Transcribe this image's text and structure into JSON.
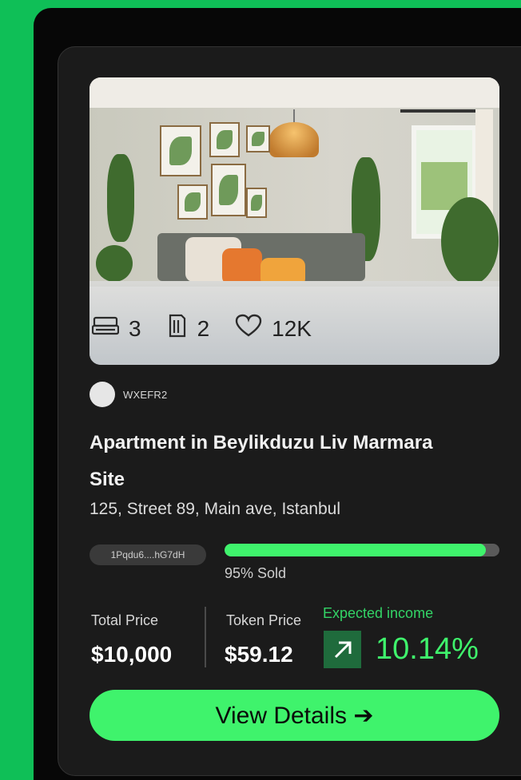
{
  "property": {
    "stats": {
      "beds": "3",
      "baths": "2",
      "likes": "12K"
    },
    "owner_code": "WXEFR2",
    "title": "Apartment in Beylikduzu Liv Marmara Site",
    "address": "125, Street 89, Main ave, Istanbul",
    "token_hash": "1Pqdu6....hG7dH",
    "sold_fraction": 0.95,
    "sold_text": "95% Sold"
  },
  "pricing": {
    "total_label": "Total Price",
    "total_value": "$10,000",
    "token_label": "Token Price",
    "token_value": "$59.12",
    "expected_label": "Expected income",
    "expected_value": "10.14%"
  },
  "cta": {
    "label": "View Details ➔"
  },
  "colors": {
    "accent": "#3ff36c",
    "background": "#0fbf57",
    "card": "#1b1b1b"
  },
  "icons": [
    "bed-icon",
    "bath-icon",
    "heart-icon",
    "trend-up-icon",
    "arrow-right-icon"
  ]
}
